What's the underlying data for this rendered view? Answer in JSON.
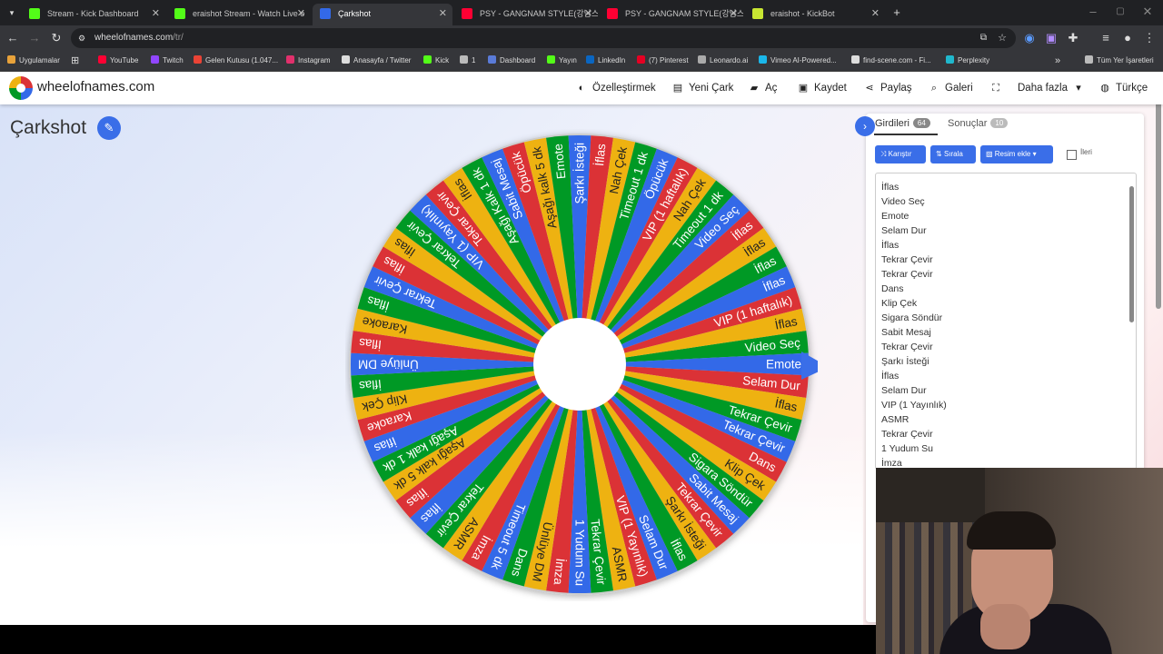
{
  "browser": {
    "tabs": [
      {
        "title": "Stream - Kick Dashboard",
        "color": "#53fc18"
      },
      {
        "title": "eraishot Stream - Watch Live o",
        "color": "#53fc18"
      },
      {
        "title": "Çarkshot",
        "color": "#3369e8"
      },
      {
        "title": "PSY - GANGNAM STYLE(강남스",
        "color": "#ff0033"
      },
      {
        "title": "PSY - GANGNAM STYLE(강남스",
        "color": "#ff0033"
      },
      {
        "title": "eraishot - KickBot",
        "color": "#c8e632"
      }
    ],
    "url_host": "wheelofnames.com",
    "url_path": "/tr/",
    "bookmarks": [
      {
        "label": "Uygulamalar",
        "color": "#e8a23a"
      },
      {
        "label": "YouTube",
        "color": "#ff0033"
      },
      {
        "label": "Twitch",
        "color": "#9146ff"
      },
      {
        "label": "Gelen Kutusu (1.047...",
        "color": "#ea4335"
      },
      {
        "label": "Instagram",
        "color": "#e1306c"
      },
      {
        "label": "Anasayfa / Twitter",
        "color": "#dddddd"
      },
      {
        "label": "Kick",
        "color": "#53fc18"
      },
      {
        "label": "1",
        "color": "#bbbbbb"
      },
      {
        "label": "Dashboard",
        "color": "#5a7bd8"
      },
      {
        "label": "Yayın",
        "color": "#53fc18"
      },
      {
        "label": "LinkedIn",
        "color": "#0a66c2"
      },
      {
        "label": "(7) Pinterest",
        "color": "#e60023"
      },
      {
        "label": "Leonardo.ai",
        "color": "#aaaaaa"
      },
      {
        "label": "Vimeo AI-Powered...",
        "color": "#1ab7ea"
      },
      {
        "label": "find-scene.com - Fi...",
        "color": "#dddddd"
      },
      {
        "label": "Perplexity",
        "color": "#20b8cd"
      }
    ],
    "all_bookmarks": "Tüm Yer İşaretleri"
  },
  "site": {
    "name": "wheelofnames.com",
    "menu": [
      {
        "label": "Özelleştirmek",
        "icon": "palette-icon",
        "glyph": "◐"
      },
      {
        "label": "Yeni Çark",
        "icon": "file-icon",
        "glyph": "▤"
      },
      {
        "label": "Aç",
        "icon": "folder-icon",
        "glyph": "▰"
      },
      {
        "label": "Kaydet",
        "icon": "save-icon",
        "glyph": "▣"
      },
      {
        "label": "Paylaş",
        "icon": "share-icon",
        "glyph": "⋖"
      },
      {
        "label": "Galeri",
        "icon": "search-icon",
        "glyph": "⌕"
      },
      {
        "label": "",
        "icon": "fullscreen-icon",
        "glyph": "⛶"
      },
      {
        "label": "Daha fazla",
        "icon": "chevron-down-icon",
        "glyph": "▾"
      },
      {
        "label": "Türkçe",
        "icon": "globe-icon",
        "glyph": "◍"
      }
    ]
  },
  "wheel": {
    "title": "Çarkshot",
    "colors": [
      "#009925",
      "#3369e8",
      "#db3236",
      "#eeb211"
    ],
    "slices": [
      "Video Seç",
      "Emote",
      "Selam Dur",
      "İflas",
      "Tekrar Çevir",
      "Tekrar Çevir",
      "Dans",
      "Klip Çek",
      "Sigara Söndür",
      "Sabit Mesaj",
      "Tekrar Çevir",
      "Şarkı İsteği",
      "İflas",
      "Selam Dur",
      "VIP (1 Yayınlık)",
      "ASMR",
      "Tekrar Çevir",
      "1 Yudum Su",
      "İmza",
      "Ünlüye DM",
      "Dans",
      "Timeout 5 dk",
      "İmza",
      "ASMR",
      "Tekrar Çevir",
      "İflas",
      "İflas",
      "Aşağı kalk 5 dk",
      "Aşağı kalk 1 dk",
      "İflas",
      "Karaoke",
      "Klip Çek",
      "İflas",
      "Ünlüye DM",
      "İflas",
      "Karaoke",
      "İflas",
      "Tekrar Çevir",
      "İflas",
      "İflas",
      "Tekrar Çevir",
      "VIP (1 Yayınlık)",
      "Tekrar Çevir",
      "İflas",
      "Aşağı Kalk 1 dk",
      "Sabit Mesaj",
      "Öpücük",
      "Aşağı kalk 5 dk",
      "Emote",
      "Şarkı İsteği",
      "İflas",
      "Nah Çek",
      "Timeout 1 dk",
      "Öpücük",
      "VIP (1 haftalık)",
      "Nah Çek",
      "Timeout 1 dk",
      "Video Seç",
      "İflas",
      "İflas",
      "İflas",
      "İflas",
      "VIP (1 haftalık)",
      "İflas"
    ]
  },
  "panel": {
    "tab_entries": "Girdileri",
    "tab_entries_count": "64",
    "tab_results": "Sonuçlar",
    "tab_results_count": "10",
    "btn_shuffle": "Karıştır",
    "btn_sort": "Sırala",
    "btn_add_image": "Resim ekle",
    "advanced_label": "İleri",
    "entries": [
      "İflas",
      "Video Seç",
      "Emote",
      "Selam Dur",
      "İflas",
      "Tekrar Çevir",
      "Tekrar Çevir",
      "Dans",
      "Klip Çek",
      "Sigara Söndür",
      "Sabit Mesaj",
      "Tekrar Çevir",
      "Şarkı İsteği",
      "İflas",
      "Selam Dur",
      "VIP (1 Yayınlık)",
      "ASMR",
      "Tekrar Çevir",
      "1 Yudum Su",
      "İmza"
    ]
  }
}
